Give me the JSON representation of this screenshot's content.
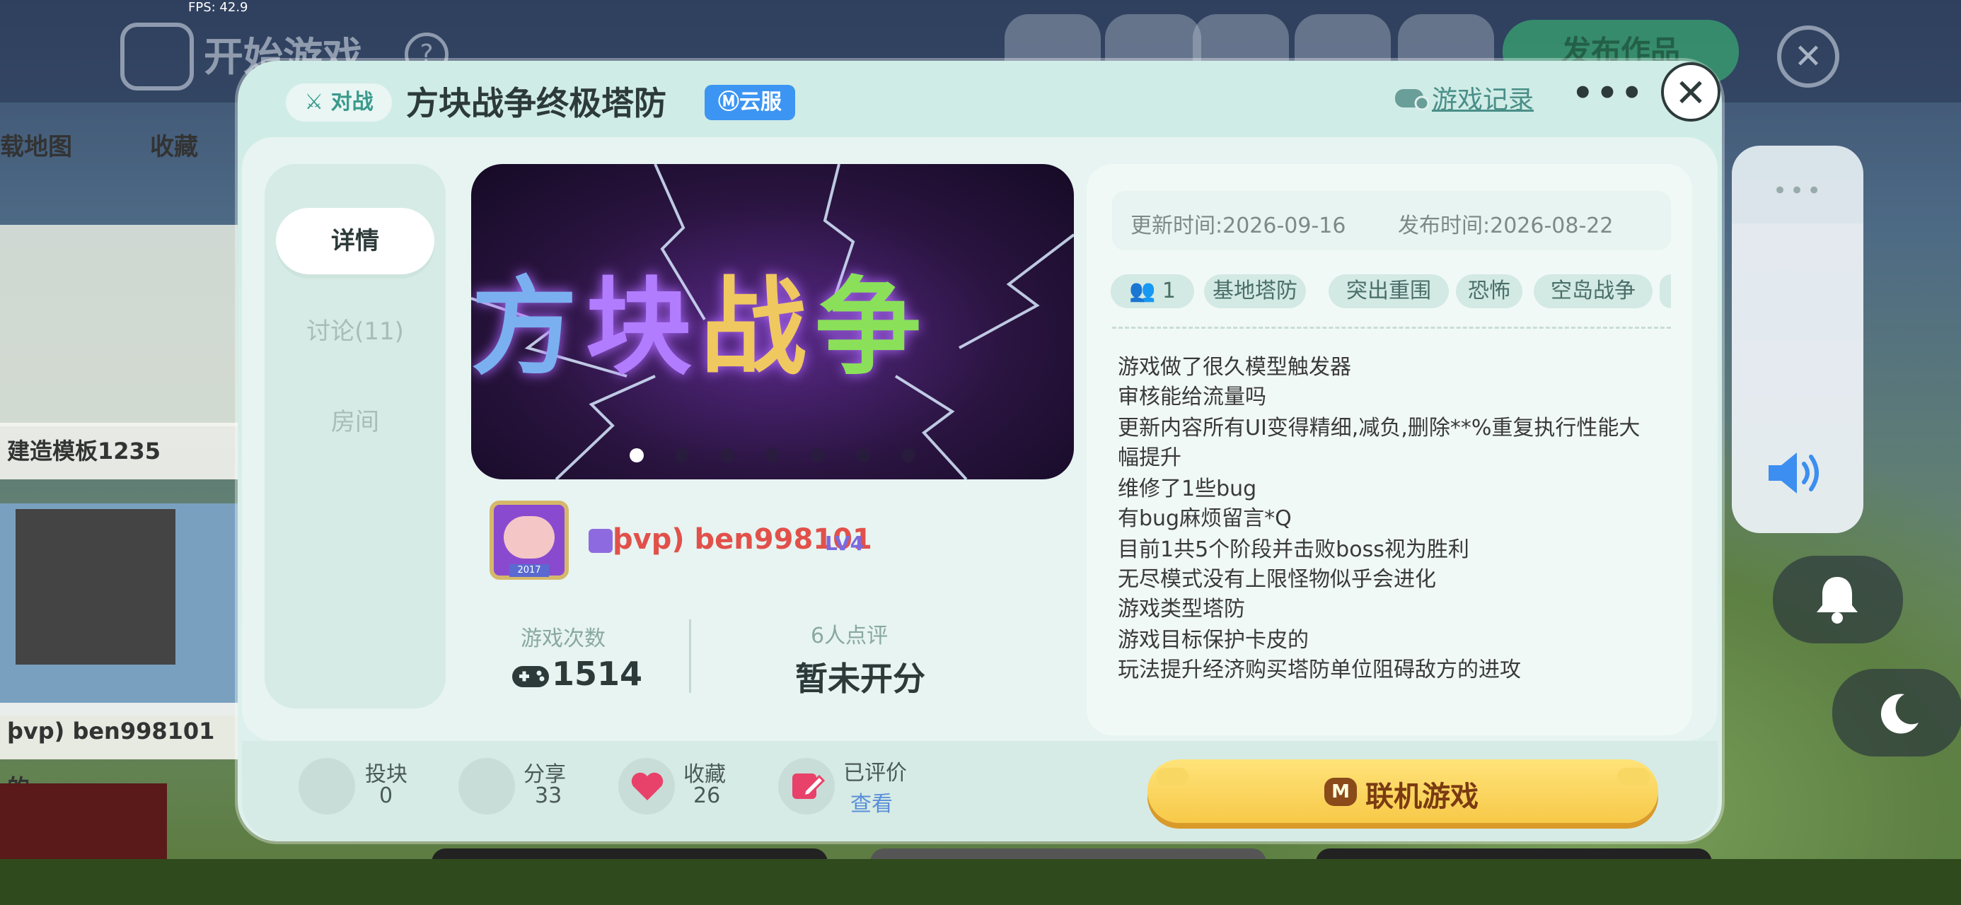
{
  "hud": {
    "fps": "FPS: 42.9"
  },
  "background": {
    "title": "开始游戏",
    "help_icon": "?",
    "publish_label": "发布作品",
    "close_icon": "✕",
    "tabs": [
      "载地图",
      "收藏"
    ],
    "cards": [
      "建造模板1235",
      "þvp) ben998101的..."
    ]
  },
  "modal": {
    "mode_tag": "对战",
    "game_title": "方块战争终极塔防",
    "cloud_badge": "云服",
    "record_label": "游戏记录",
    "more_icon": "•••",
    "close_icon": "✕",
    "nav": [
      {
        "label": "详情",
        "active": true
      },
      {
        "label": "讨论(11)",
        "active": false
      },
      {
        "label": "房间",
        "active": false
      }
    ],
    "banner": {
      "chars": [
        "方",
        "块",
        "战",
        "争"
      ],
      "slides_total": 7,
      "slide_active": 1
    },
    "author": {
      "name": "þvp) ben998101",
      "level": "LV4",
      "avatar_year": "2017"
    },
    "stats": {
      "plays_label": "游戏次数",
      "plays_value": "1514",
      "rating_label": "6人点评",
      "rating_value": "暂未开分"
    },
    "info": {
      "update_time": "更新时间:2026-09-16",
      "publish_time": "发布时间:2026-08-22",
      "players": "1",
      "tags": [
        "基地塔防",
        "突出重围",
        "恐怖",
        "空岛战争"
      ],
      "description": [
        "游戏做了很久模型触发器",
        "审核能给流量吗",
        "更新内容所有UI变得精细,减负,删除**%重复执行性能大",
        "幅提升",
        "维修了1些bug",
        "有bug麻烦留言*Q",
        "目前1共5个阶段并击败boss视为胜利",
        "无尽模式没有上限怪物似乎会进化",
        "游戏类型塔防",
        "游戏目标保护卡皮的",
        "玩法提升经济购买塔防单位阻碍敌方的进攻"
      ]
    },
    "actions": {
      "block_label": "投块",
      "block_value": "0",
      "share_label": "分享",
      "share_value": "33",
      "fav_label": "收藏",
      "fav_value": "26",
      "rated_label": "已评价",
      "rated_link": "查看",
      "play_label": "联机游戏",
      "play_icon": "M"
    }
  },
  "colors": {
    "accent_teal": "#3a9a8c",
    "cloud_blue": "#3c95f2",
    "author_red": "#e2504a",
    "play_yellow": "#f7c948"
  }
}
